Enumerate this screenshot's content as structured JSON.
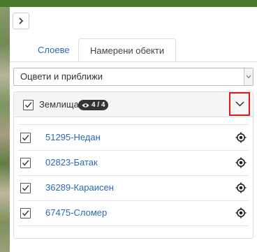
{
  "panel": {
    "collapse_icon": "chevron-right-icon"
  },
  "tabs": [
    {
      "label": "Слоеве",
      "active": false
    },
    {
      "label": "Намерени обекти",
      "active": true
    }
  ],
  "filter_select": {
    "value": "Оцвети и приближи"
  },
  "layer": {
    "title": "Землища",
    "badge_icon": "eye-icon",
    "badge_count": "4 / 4",
    "checked": true,
    "expand_icon": "chevron-down-icon",
    "highlight_color": "#e01919"
  },
  "items": [
    {
      "label": "51295-Недан",
      "checked": true
    },
    {
      "label": "02823-Батак",
      "checked": true
    },
    {
      "label": "36289-Караисен",
      "checked": true
    },
    {
      "label": "67475-Сломер",
      "checked": true
    }
  ],
  "colors": {
    "link": "#2a6ab3",
    "top_bar": "#4a7a2c",
    "badge_bg": "#333333"
  }
}
